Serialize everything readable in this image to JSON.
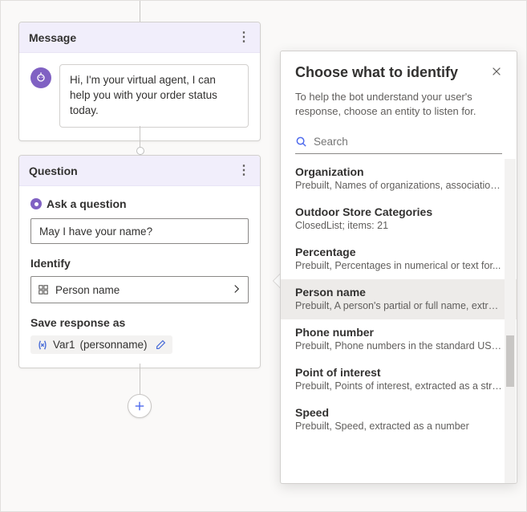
{
  "message_node": {
    "title": "Message",
    "text": "Hi, I'm your virtual agent, I can help you with your order status today."
  },
  "question_node": {
    "title": "Question",
    "ask_label": "Ask a question",
    "ask_value": "May I have your name?",
    "identify_label": "Identify",
    "identify_value": "Person name",
    "save_label": "Save response as",
    "var_name": "Var1",
    "var_type": "(personname)"
  },
  "panel": {
    "title": "Choose what to identify",
    "description": "To help the bot understand your user's response, choose an entity to listen for.",
    "search_placeholder": "Search",
    "entities": [
      {
        "name": "Organization",
        "desc": "Prebuilt, Names of organizations, associations,",
        "selected": false
      },
      {
        "name": "Outdoor Store Categories",
        "desc": "ClosedList; items: 21",
        "selected": false
      },
      {
        "name": "Percentage",
        "desc": "Prebuilt, Percentages in numerical or text for...",
        "selected": false
      },
      {
        "name": "Person name",
        "desc": "Prebuilt, A person's partial or full name, extra...",
        "selected": true
      },
      {
        "name": "Phone number",
        "desc": "Prebuilt, Phone numbers in the standard US f...",
        "selected": false
      },
      {
        "name": "Point of interest",
        "desc": "Prebuilt, Points of interest, extracted as a string",
        "selected": false
      },
      {
        "name": "Speed",
        "desc": "Prebuilt, Speed, extracted as a number",
        "selected": false
      }
    ]
  }
}
